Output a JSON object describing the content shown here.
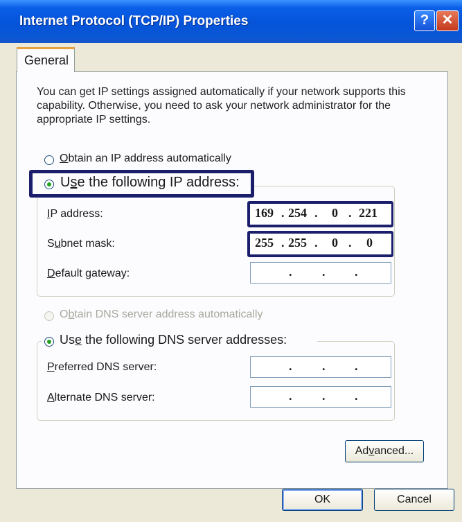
{
  "window": {
    "title": "Internet Protocol (TCP/IP) Properties",
    "help_glyph": "?",
    "close_glyph": "✕"
  },
  "tabs": [
    {
      "label": "General"
    }
  ],
  "intro_text": "You can get IP settings assigned automatically if your network supports this capability. Otherwise, you need to ask your network administrator for the appropriate IP settings.",
  "ip_section": {
    "obtain_auto": {
      "label_accel": "O",
      "label_rest": "btain an IP address automatically",
      "selected": false
    },
    "use_following": {
      "label_pre": "U",
      "label_accel": "s",
      "label_rest": "e the following IP address:",
      "selected": true
    },
    "fields": {
      "ip_address": {
        "label_accel": "I",
        "label_rest": "P address:",
        "octets": [
          "169",
          "254",
          "0",
          "221"
        ]
      },
      "subnet_mask": {
        "label_pre": "S",
        "label_accel": "u",
        "label_rest": "bnet mask:",
        "octets": [
          "255",
          "255",
          "0",
          "0"
        ]
      },
      "default_gateway": {
        "label_accel": "D",
        "label_rest": "efault gateway:",
        "octets": [
          "",
          "",
          "",
          ""
        ]
      }
    }
  },
  "dns_section": {
    "obtain_auto": {
      "label_pre": "O",
      "label_accel": "b",
      "label_rest": "tain DNS server address automatically",
      "selected": false,
      "enabled": false
    },
    "use_following": {
      "label_pre": "Us",
      "label_accel": "e",
      "label_rest": " the following DNS server addresses:",
      "selected": true
    },
    "fields": {
      "preferred": {
        "label_accel": "P",
        "label_rest": "referred DNS server:",
        "octets": [
          "",
          "",
          "",
          ""
        ]
      },
      "alternate": {
        "label_accel": "A",
        "label_rest": "lternate DNS server:",
        "octets": [
          "",
          "",
          "",
          ""
        ]
      }
    }
  },
  "buttons": {
    "advanced": {
      "label_pre": "Ad",
      "label_accel": "v",
      "label_rest": "anced..."
    },
    "ok": "OK",
    "cancel": "Cancel"
  },
  "colors": {
    "titlebar": "#0553d8",
    "dialog_bg": "#ece9d8",
    "highlight_box": "#1b1f6b",
    "radio_dot": "#21a121",
    "tab_accent": "#e6a23c"
  }
}
